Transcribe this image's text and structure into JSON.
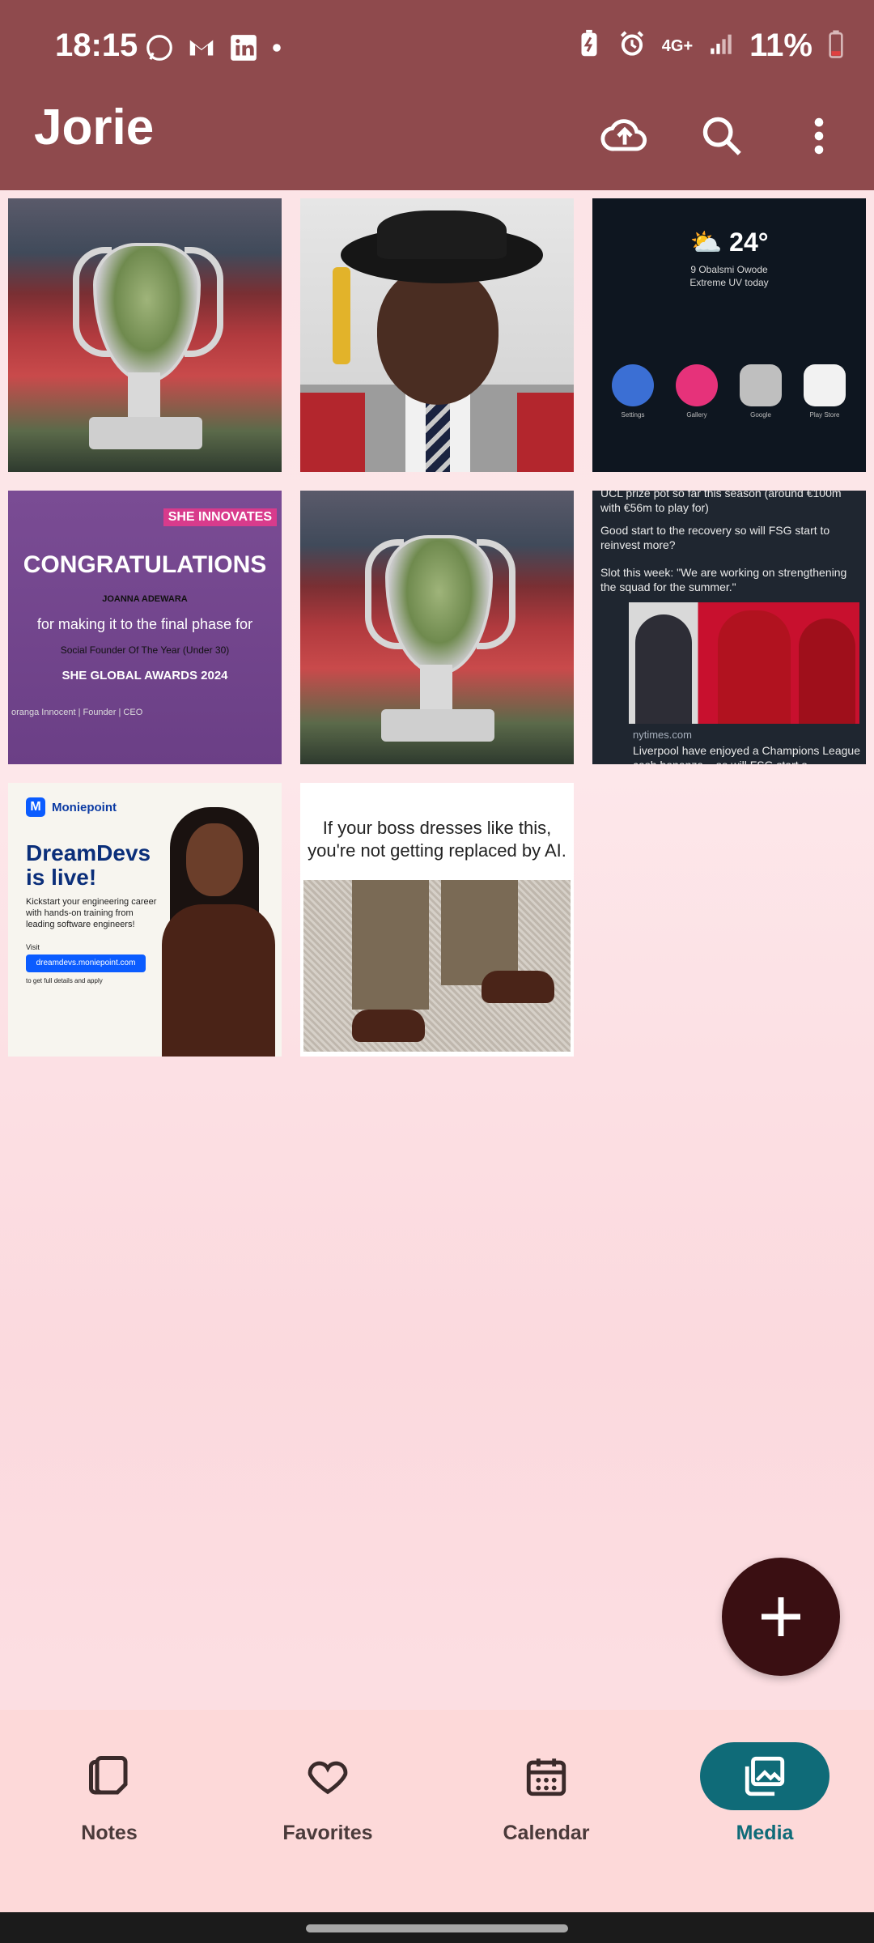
{
  "status_bar": {
    "time": "18:15",
    "battery": "11%",
    "network": "4G+",
    "left_icons": [
      "whatsapp-icon",
      "gmail-icon",
      "linkedin-icon",
      "dot-icon"
    ],
    "right_icons": [
      "battery-saver-icon",
      "alarm-icon",
      "network-4g-icon",
      "signal-icon",
      "battery-low-icon"
    ]
  },
  "app_bar": {
    "title": "Jorie",
    "actions": [
      "cloud-upload-icon",
      "search-icon",
      "more-vert-icon"
    ]
  },
  "grid": {
    "tile3": {
      "temp": "24°",
      "line1": "9 Obalsmi Owode",
      "line2": "Extreme UV today",
      "apps": [
        "Settings",
        "Gallery",
        "Google",
        "Play Store"
      ]
    },
    "tile4": {
      "badge": "SHE INNOVATES",
      "title": "CONGRATULATIONS",
      "name": "JOANNA ADEWARA",
      "line1": "for making it to the final phase for",
      "line2": "Social Founder Of The Year (Under 30)",
      "line3": "SHE GLOBAL AWARDS 2024",
      "footer": "oranga Innocent | Founder | CEO"
    },
    "tile6": {
      "p1": "UCL prize pot so far this season (around €100m with €56m to play for)",
      "p2": "Good start to the recovery so will FSG start to reinvest more?",
      "p3": "Slot this week: \"We are working on strengthening the squad for the summer.\"",
      "source": "nytimes.com",
      "headline": "Liverpool have enjoyed a Champions League cash bonanza – so will FSG start s..."
    },
    "tile7": {
      "brand": "Moniepoint",
      "title": "DreamDevs is live!",
      "desc": "Kickstart your engineering career with hands-on training from leading software engineers!",
      "visit": "Visit",
      "link": "dreamdevs.moniepoint.com",
      "apply": "to get full details and apply"
    },
    "tile8": {
      "caption": "If your boss dresses like this, you're not getting replaced by AI."
    }
  },
  "fab": {
    "icon": "plus-icon"
  },
  "bottom_nav": {
    "items": [
      {
        "label": "Notes",
        "icon": "notes-icon"
      },
      {
        "label": "Favorites",
        "icon": "heart-icon"
      },
      {
        "label": "Calendar",
        "icon": "calendar-icon"
      },
      {
        "label": "Media",
        "icon": "media-icon"
      }
    ],
    "active": "Media",
    "active_color": "#0f6b78"
  },
  "colors": {
    "app_bar": "#8f4a4d",
    "fab": "#3a0f12",
    "nav_bg": "#fdd9d9"
  }
}
